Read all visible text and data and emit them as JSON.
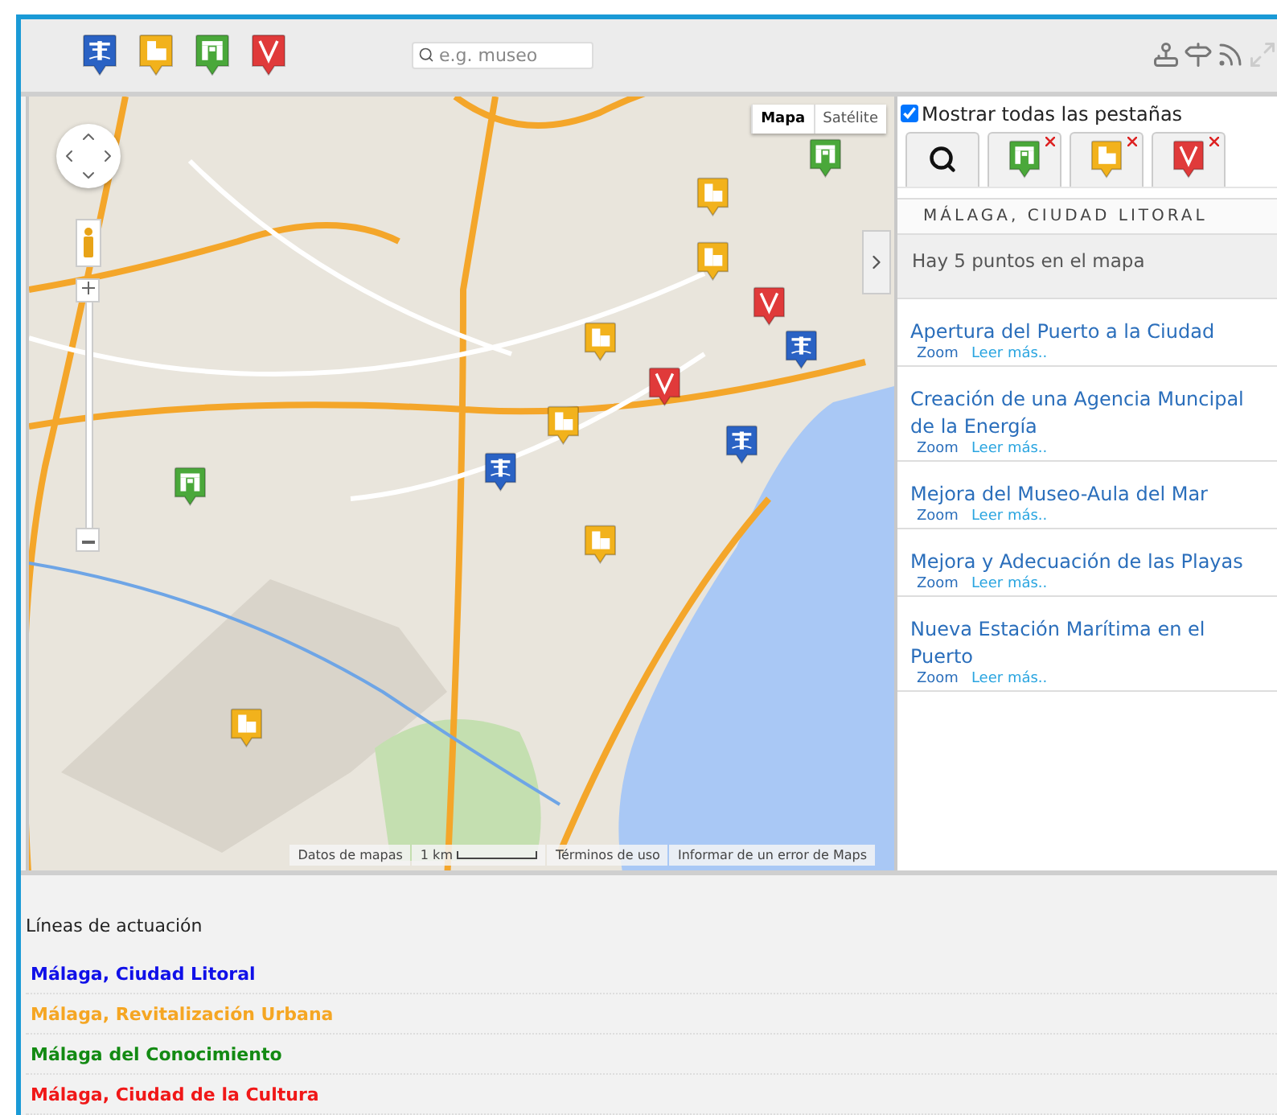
{
  "toolbar": {
    "categories": [
      {
        "kind": "palm",
        "color": "#2a62c4"
      },
      {
        "kind": "building",
        "color": "#f2b21c"
      },
      {
        "kind": "arch",
        "color": "#4aa83a"
      },
      {
        "kind": "v",
        "color": "#e03a3a"
      }
    ],
    "search": {
      "placeholder": "e.g. museo"
    }
  },
  "map": {
    "map_types": [
      {
        "label": "Mapa",
        "selected": true
      },
      {
        "label": "Satélite",
        "selected": false
      }
    ],
    "footer": {
      "data": "Datos de mapas",
      "scale": "1 km",
      "terms": "Términos de uso",
      "report": "Informar de un error de Maps"
    }
  },
  "panel": {
    "show_all": {
      "label": "Mostrar todas las pestañas",
      "checked": true
    },
    "tabs": [
      {
        "kind": "search",
        "closable": false
      },
      {
        "kind": "arch",
        "color": "#4aa83a",
        "closable": true
      },
      {
        "kind": "building",
        "color": "#f2b21c",
        "closable": true
      },
      {
        "kind": "v",
        "color": "#e03a3a",
        "closable": true
      }
    ],
    "heading": "MÁLAGA, CIUDAD LITORAL",
    "count": "Hay 5 puntos en el mapa",
    "items": [
      {
        "title": "Apertura del Puerto a la Ciudad",
        "zoom": "Zoom",
        "more": "Leer más.."
      },
      {
        "title": "Creación de una Agencia Muncipal de la Energía",
        "zoom": "Zoom",
        "more": "Leer más.."
      },
      {
        "title": "Mejora del Museo-Aula del Mar",
        "zoom": "Zoom",
        "more": "Leer más.."
      },
      {
        "title": "Mejora y Adecuación de las Playas",
        "zoom": "Zoom",
        "more": "Leer más.."
      },
      {
        "title": "Nueva Estación Marítima en el Puerto",
        "zoom": "Zoom",
        "more": "Leer más.."
      }
    ]
  },
  "lines": {
    "title": "Líneas de actuación",
    "items": [
      {
        "label": "Málaga, Ciudad Litoral",
        "color": "#1010e8"
      },
      {
        "label": "Málaga, Revitalización Urbana",
        "color": "#f5a623"
      },
      {
        "label": "Málaga del Conocimiento",
        "color": "#138a13"
      },
      {
        "label": "Málaga, Ciudad de la Cultura",
        "color": "#f01818"
      }
    ]
  }
}
